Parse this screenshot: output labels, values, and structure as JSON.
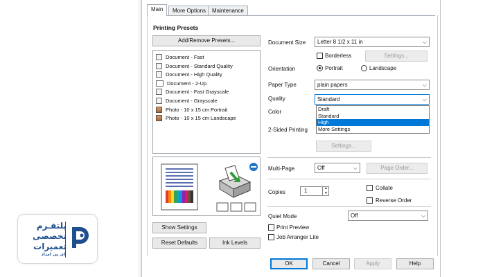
{
  "tabs": [
    "Main",
    "More Options",
    "Maintenance"
  ],
  "printing_presets": {
    "title": "Printing Presets",
    "add_remove_button": "Add/Remove Presets...",
    "items": [
      "Document - Fast",
      "Document - Standard Quality",
      "Document - High Quality",
      "Document - 2-Up",
      "Document - Fast Grayscale",
      "Document - Grayscale",
      "Photo - 10 x 15 cm Portrait",
      "Photo - 10 x 15 cm Landscape"
    ]
  },
  "settings": {
    "document_size_label": "Document Size",
    "document_size_value": "Letter 8 1/2 x 11 in",
    "borderless_label": "Borderless",
    "borderless_settings_button": "Settings...",
    "orientation_label": "Orientation",
    "portrait_label": "Portrait",
    "landscape_label": "Landscape",
    "orientation_value": "Portrait",
    "paper_type_label": "Paper Type",
    "paper_type_value": "plain papers",
    "quality_label": "Quality",
    "quality_value": "Standard",
    "quality_options": [
      "Draft",
      "Standard",
      "High",
      "More Settings"
    ],
    "quality_highlighted": "High",
    "color_label": "Color",
    "two_sided_label": "2-Sided Printing",
    "two_sided_settings_button": "Settings...",
    "multi_page_label": "Multi-Page",
    "multi_page_value": "Off",
    "page_order_button": "Page Order...",
    "copies_label": "Copies",
    "copies_value": "1",
    "collate_label": "Collate",
    "reverse_order_label": "Reverse Order",
    "quiet_mode_label": "Quiet Mode",
    "quiet_mode_value": "Off",
    "print_preview_label": "Print Preview",
    "job_arranger_label": "Job Arranger Lite"
  },
  "bottom_left_buttons": {
    "show_settings": "Show Settings",
    "reset_defaults": "Reset Defaults",
    "ink_levels": "Ink Levels"
  },
  "footer_buttons": {
    "ok": "OK",
    "cancel": "Cancel",
    "apply": "Apply",
    "help": "Help"
  },
  "logo": {
    "line1": "پلتفـرم",
    "line2": "تخصصی",
    "line3": "تعمیرات",
    "sub": "ای پی امداد",
    "color": "#1f4f8d"
  },
  "colors": {
    "accent": "#0078d7"
  }
}
